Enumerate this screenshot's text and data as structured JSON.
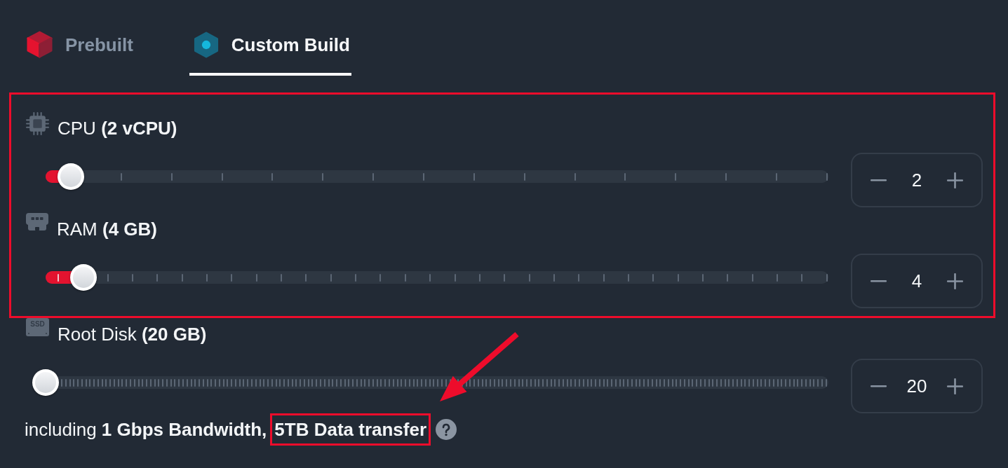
{
  "tabs": [
    {
      "label": "Prebuilt",
      "kind": "prebuilt",
      "selected": false
    },
    {
      "label": "Custom Build",
      "kind": "custom",
      "selected": true
    }
  ],
  "resources": [
    {
      "kind": "cpu",
      "label": "CPU **(2 vCPU)**",
      "level": 0.032,
      "value": "2",
      "highlighted": true
    },
    {
      "kind": "ram",
      "label": "RAM **(4 GB)**",
      "level": 0.048,
      "value": "4",
      "highlighted": true
    },
    {
      "kind": "disk",
      "badge": "SSD",
      "label": "Root Disk **(20 GB)**",
      "level": 0,
      "value": "20",
      "highlighted": false
    }
  ],
  "footnote": [
    {
      "text": "including **1 Gbps Bandwidth,**",
      "bold": false,
      "highlighted": false,
      "arrow": false
    },
    {
      "text": "5TB Data transfer",
      "bold": true,
      "highlighted": true,
      "arrow": true
    }
  ]
}
